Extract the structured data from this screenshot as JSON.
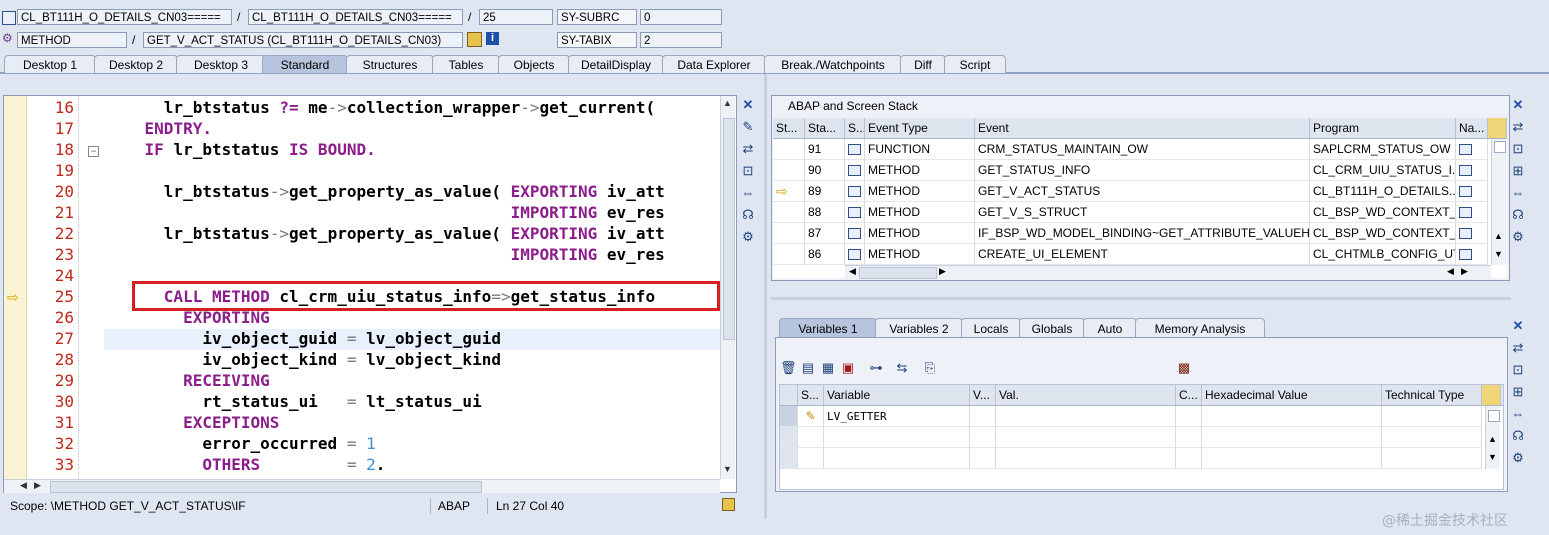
{
  "header": {
    "class_field": "CL_BT111H_O_DETAILS_CN03=====",
    "class_field2": "CL_BT111H_O_DETAILS_CN03=====",
    "line_field": "25",
    "type_field": "METHOD",
    "method_field": "GET_V_ACT_STATUS (CL_BT111H_O_DETAILS_CN03)",
    "sysvars": [
      {
        "name": "SY-SUBRC",
        "value": "0"
      },
      {
        "name": "SY-TABIX",
        "value": "2"
      }
    ]
  },
  "main_tabs": [
    "Desktop 1",
    "Desktop 2",
    "Desktop 3",
    "Standard",
    "Structures",
    "Tables",
    "Objects",
    "DetailDisplay",
    "Data Explorer",
    "Break./Watchpoints",
    "Diff",
    "Script"
  ],
  "active_tab": "Standard",
  "code": {
    "lines": [
      {
        "n": "16",
        "parts": [
          [
            "t",
            "      lr_btstatus "
          ],
          [
            "k",
            "?="
          ],
          [
            "t",
            " me"
          ],
          [
            "o",
            "->"
          ],
          [
            "t",
            "collection_wrapper"
          ],
          [
            "o",
            "->"
          ],
          [
            "t",
            "get_current( "
          ]
        ]
      },
      {
        "n": "17",
        "parts": [
          [
            "k",
            "    ENDTRY."
          ]
        ]
      },
      {
        "n": "18",
        "parts": [
          [
            "k",
            "    IF "
          ],
          [
            "t",
            "lr_btstatus "
          ],
          [
            "k",
            "IS BOUND."
          ]
        ]
      },
      {
        "n": "19",
        "parts": []
      },
      {
        "n": "20",
        "parts": [
          [
            "t",
            "      lr_btstatus"
          ],
          [
            "o",
            "->"
          ],
          [
            "t",
            "get_property_as_value( "
          ],
          [
            "k",
            "EXPORTING "
          ],
          [
            "t",
            "iv_att"
          ]
        ]
      },
      {
        "n": "21",
        "parts": [
          [
            "t",
            "                                          "
          ],
          [
            "k",
            "IMPORTING "
          ],
          [
            "t",
            "ev_res"
          ]
        ]
      },
      {
        "n": "22",
        "parts": [
          [
            "t",
            "      lr_btstatus"
          ],
          [
            "o",
            "->"
          ],
          [
            "t",
            "get_property_as_value( "
          ],
          [
            "k",
            "EXPORTING "
          ],
          [
            "t",
            "iv_att"
          ]
        ]
      },
      {
        "n": "23",
        "parts": [
          [
            "t",
            "                                          "
          ],
          [
            "k",
            "IMPORTING "
          ],
          [
            "t",
            "ev_res"
          ]
        ]
      },
      {
        "n": "24",
        "parts": []
      },
      {
        "n": "25",
        "parts": [
          [
            "k",
            "      CALL METHOD "
          ],
          [
            "t",
            "cl_crm_uiu_status_info"
          ],
          [
            "o",
            "=>"
          ],
          [
            "t",
            "get_status_info"
          ]
        ]
      },
      {
        "n": "26",
        "parts": [
          [
            "k",
            "        EXPORTING"
          ]
        ]
      },
      {
        "n": "27",
        "parts": [
          [
            "t",
            "          iv_object_guid "
          ],
          [
            "o",
            "="
          ],
          [
            "t",
            " lv_object_guid"
          ]
        ]
      },
      {
        "n": "28",
        "parts": [
          [
            "t",
            "          iv_object_kind "
          ],
          [
            "o",
            "="
          ],
          [
            "t",
            " lv_object_kind"
          ]
        ]
      },
      {
        "n": "29",
        "parts": [
          [
            "k",
            "        RECEIVING"
          ]
        ]
      },
      {
        "n": "30",
        "parts": [
          [
            "t",
            "          rt_status_ui   "
          ],
          [
            "o",
            "="
          ],
          [
            "t",
            " lt_status_ui"
          ]
        ]
      },
      {
        "n": "31",
        "parts": [
          [
            "k",
            "        EXCEPTIONS"
          ]
        ]
      },
      {
        "n": "32",
        "parts": [
          [
            "t",
            "          error_occurred "
          ],
          [
            "o",
            "="
          ],
          [
            "t",
            " "
          ],
          [
            "n",
            "1"
          ]
        ]
      },
      {
        "n": "33",
        "parts": [
          [
            "k",
            "          OTHERS         "
          ],
          [
            "o",
            "="
          ],
          [
            "t",
            " "
          ],
          [
            "n",
            "2"
          ],
          [
            "t",
            "."
          ]
        ]
      }
    ]
  },
  "status_bar": {
    "scope": "Scope: \\METHOD GET_V_ACT_STATUS\\IF",
    "lang": "ABAP",
    "position": "Ln  27 Col  40"
  },
  "stack": {
    "title": "ABAP and Screen Stack",
    "columns": [
      "St...",
      "Sta...",
      "S...",
      "Event Type",
      "Event",
      "Program",
      "Na..."
    ],
    "rows": [
      {
        "level": "91",
        "type": "FUNCTION",
        "event": "CRM_STATUS_MAINTAIN_OW",
        "program": "SAPLCRM_STATUS_OW",
        "current": false
      },
      {
        "level": "90",
        "type": "METHOD",
        "event": "GET_STATUS_INFO",
        "program": "CL_CRM_UIU_STATUS_I...",
        "current": false
      },
      {
        "level": "89",
        "type": "METHOD",
        "event": "GET_V_ACT_STATUS",
        "program": "CL_BT111H_O_DETAILS...",
        "current": true
      },
      {
        "level": "88",
        "type": "METHOD",
        "event": "GET_V_S_STRUCT",
        "program": "CL_BSP_WD_CONTEXT_...",
        "current": false
      },
      {
        "level": "87",
        "type": "METHOD",
        "event": "IF_BSP_WD_MODEL_BINDING~GET_ATTRIBUTE_VALUEH...",
        "program": "CL_BSP_WD_CONTEXT_...",
        "current": false
      },
      {
        "level": "86",
        "type": "METHOD",
        "event": "CREATE_UI_ELEMENT",
        "program": "CL_CHTMLB_CONFIG_UT...",
        "current": false
      }
    ]
  },
  "var_tabs": [
    "Variables 1",
    "Variables 2",
    "Locals",
    "Globals",
    "Auto",
    "Memory Analysis"
  ],
  "active_var_tab": "Variables 1",
  "vars": {
    "columns": [
      "S...",
      "Variable",
      "V...",
      "Val.",
      "C...",
      "Hexadecimal Value",
      "Technical Type"
    ],
    "rows": [
      {
        "variable": "LV_GETTER"
      }
    ]
  },
  "watermark": "@稀土掘金技术社区"
}
